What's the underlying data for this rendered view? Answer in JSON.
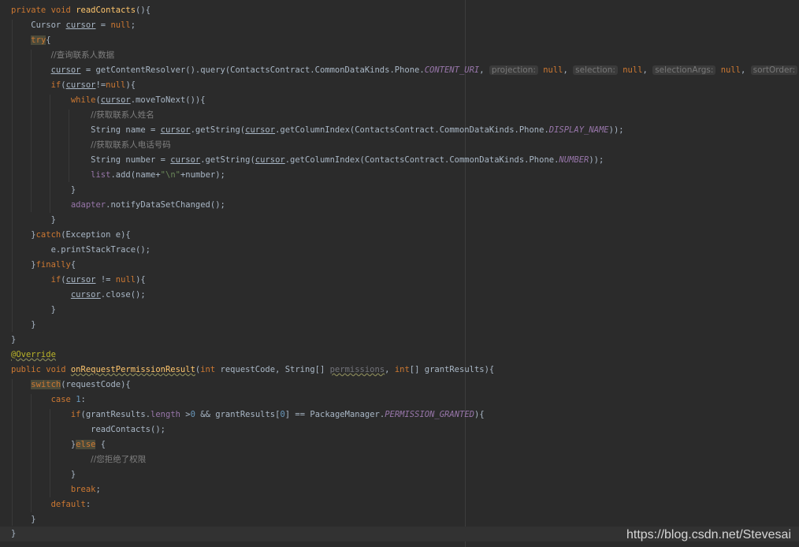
{
  "editor": {
    "watermark": "https://blog.csdn.net/Stevesai",
    "comments": {
      "query_contacts": "//查询联系人数据",
      "get_name": "//获取联系人姓名",
      "get_number": "//获取联系人电话号码",
      "denied": "//您拒绝了权限"
    },
    "hints": {
      "projection": "projection:",
      "selection": "selection:",
      "selection_args": "selectionArgs:",
      "sort_order": "sortOrder:"
    }
  },
  "colors": {
    "background": "#2b2b2b",
    "keyword": "#cc7832",
    "method": "#ffc66d",
    "constant": "#9876aa",
    "comment": "#808080",
    "number": "#6897bb",
    "string": "#6a8759",
    "annotation": "#bbb529"
  }
}
